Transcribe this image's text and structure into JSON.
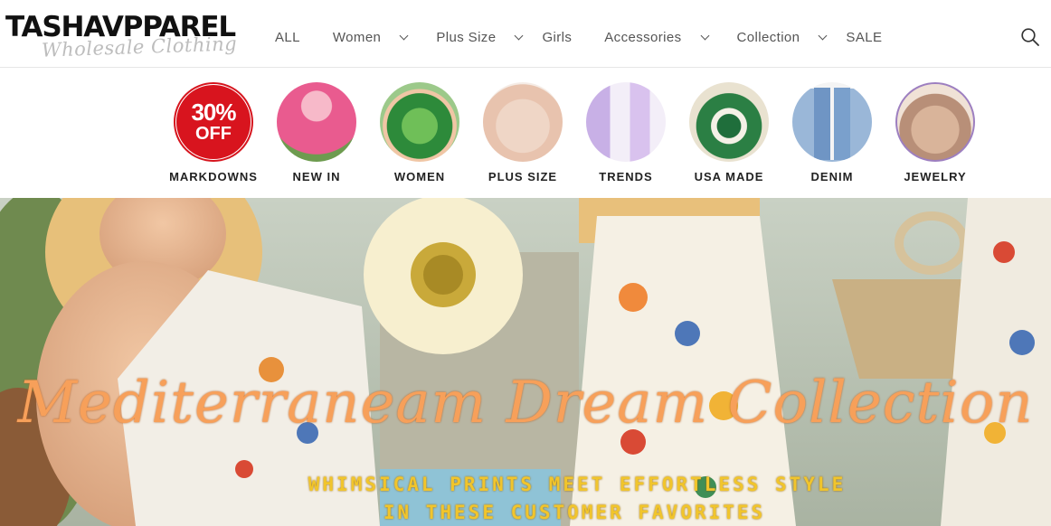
{
  "header": {
    "logo": {
      "main": "TASHAVPPAREL",
      "tagline": "Wholesale Clothing"
    },
    "nav": [
      {
        "label": "ALL",
        "has_dropdown": false
      },
      {
        "label": "Women",
        "has_dropdown": true
      },
      {
        "label": "Plus Size",
        "has_dropdown": true
      },
      {
        "label": "Girls",
        "has_dropdown": false
      },
      {
        "label": "Accessories",
        "has_dropdown": true
      },
      {
        "label": "Collection",
        "has_dropdown": true
      },
      {
        "label": "SALE",
        "has_dropdown": false
      }
    ],
    "search_icon": "search-icon"
  },
  "categories": [
    {
      "label": "MARKDOWNS",
      "badge_percent": "30%",
      "badge_off": "OFF",
      "accent": "#d8141e"
    },
    {
      "label": "NEW IN"
    },
    {
      "label": "WOMEN"
    },
    {
      "label": "PLUS SIZE"
    },
    {
      "label": "TRENDS"
    },
    {
      "label": "USA MADE"
    },
    {
      "label": "DENIM"
    },
    {
      "label": "JEWELRY"
    }
  ],
  "hero": {
    "title": "Mediterraneam Dream Collection",
    "subtitle_line1": "WHIMSICAL PRINTS MEET EFFORTLESS STYLE",
    "subtitle_line2": "IN THESE CUSTOMER FAVORITES",
    "title_color": "#f7a05a",
    "subtitle_color": "#f1c52c"
  }
}
